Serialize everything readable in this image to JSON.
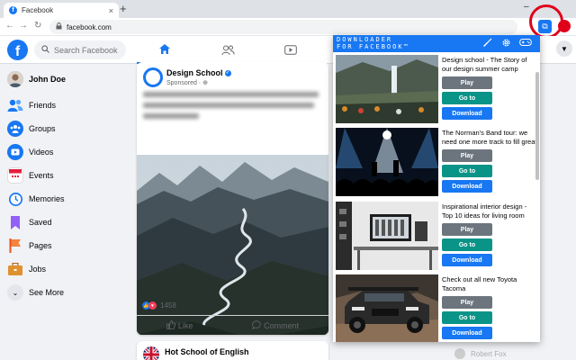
{
  "browser": {
    "tab_title": "Facebook",
    "url": "facebook.com",
    "new_tab_glyph": "+",
    "close_glyph": "×"
  },
  "header": {
    "logo_letter": "f",
    "search_placeholder": "Search Facebook"
  },
  "sidebar": {
    "items": [
      {
        "label": "John Doe"
      },
      {
        "label": "Friends"
      },
      {
        "label": "Groups"
      },
      {
        "label": "Videos"
      },
      {
        "label": "Events"
      },
      {
        "label": "Memories"
      },
      {
        "label": "Saved"
      },
      {
        "label": "Pages"
      },
      {
        "label": "Jobs"
      },
      {
        "label": "See More"
      }
    ]
  },
  "post": {
    "author": "Design School",
    "sponsored": "Sponsored",
    "reaction_count": "1458",
    "like_label": "Like",
    "comment_label": "Comment"
  },
  "post2": {
    "author": "Hot School of English"
  },
  "contact": {
    "name": "Robert Fox"
  },
  "extension": {
    "title_line1": "DOWNLOADER",
    "title_line2": "FOR FACEBOOK™",
    "items": [
      {
        "desc": "Design school - The Story of our design summer camp",
        "play": "Play",
        "goto": "Go to",
        "download": "Download"
      },
      {
        "desc": "The Norman's Band tour: we need one more track to fill great",
        "play": "Play",
        "goto": "Go to",
        "download": "Download"
      },
      {
        "desc": "Inspirational interior design - Top 10 ideas for living room",
        "play": "Play",
        "goto": "Go to",
        "download": "Download"
      },
      {
        "desc": "Check out all new Toyota Tacoma",
        "play": "Play",
        "goto": "Go to",
        "download": "Download"
      }
    ]
  },
  "colors": {
    "facebook_blue": "#1877f2",
    "go_to_teal": "#0a9488",
    "play_gray": "#6c757d",
    "highlight_red": "#e0001a"
  }
}
